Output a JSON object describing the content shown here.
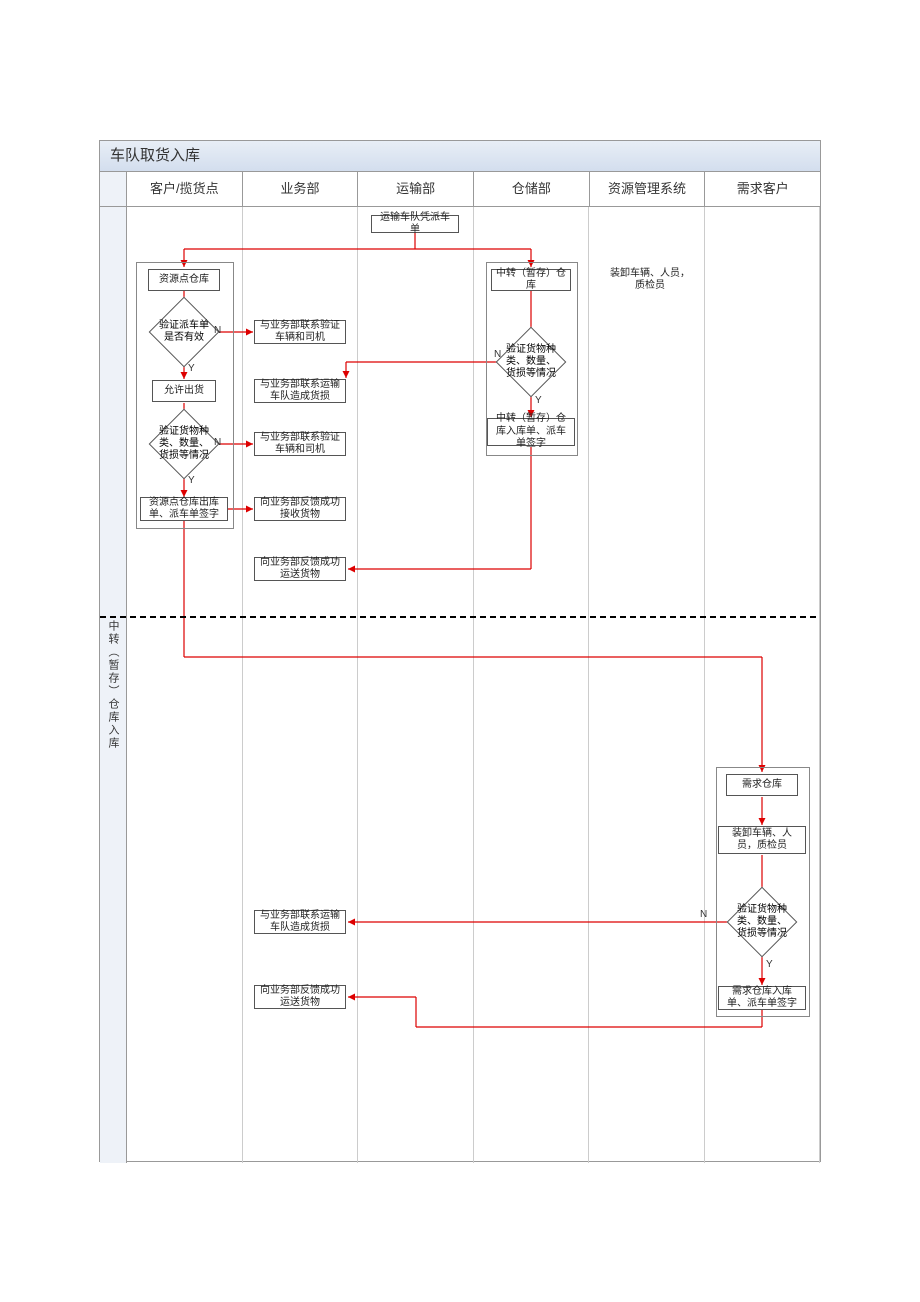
{
  "title": "车队取货入库",
  "row_label": "中转（暂存）仓库入库",
  "lanes": [
    "客户/揽货点",
    "业务部",
    "运输部",
    "仓储部",
    "资源管理系统",
    "需求客户"
  ],
  "nodes": {
    "n_start": "运输车队凭派车单",
    "n_res_wh": "资源点仓库",
    "n_transit_wh": "中转（暂存）仓库",
    "n_verif_dispatch": "验证派车单是否有效",
    "n_contact_vehicle1": "与业务部联系验证车辆和司机",
    "n_allow_ship": "允许出货",
    "n_contact_damage1": "与业务部联系运输车队造成货损",
    "n_res_staff": "装卸车辆、人员，质检员",
    "n_verif_goods_c": "验证货物种类、数量、货损等情况",
    "n_verif_goods_s": "验证货物种类、数量、货损等情况",
    "n_contact_vehicle2": "与业务部联系验证车辆和司机",
    "n_transit_sign": "中转（暂存）仓库入库单、派车单签字",
    "n_outbound_sign": "资源点仓库出库单、派车单签字",
    "n_feedback_recv": "向业务部反馈成功接收货物",
    "n_feedback_ship1": "向业务部反馈成功运送货物",
    "n_demand_wh": "需求仓库",
    "n_demand_staff": "装卸车辆、人员，质检员",
    "n_verif_goods_d": "验证货物种类、数量、货损等情况",
    "n_contact_damage2": "与业务部联系运输车队造成货损",
    "n_feedback_ship2": "向业务部反馈成功运送货物",
    "n_demand_sign": "需求仓库入库单、派车单签字"
  },
  "labels": {
    "Y": "Y",
    "N": "N"
  }
}
